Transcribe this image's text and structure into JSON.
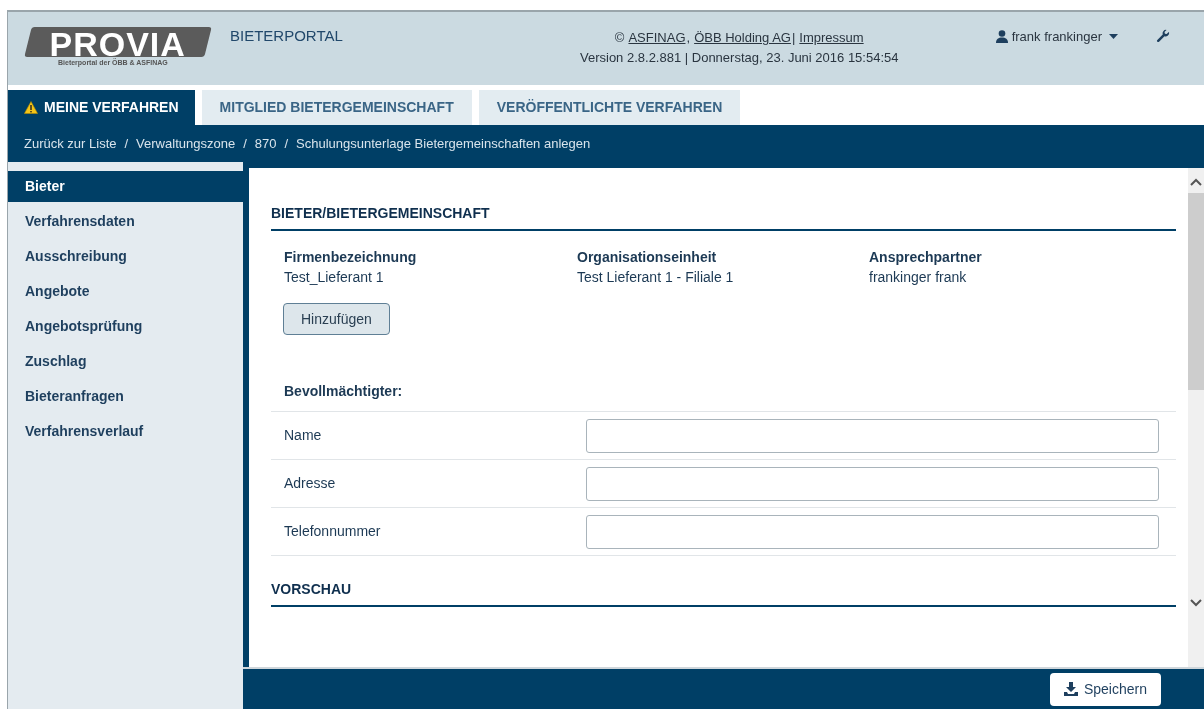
{
  "header": {
    "logo_text": "PROVIA",
    "logo_subtitle": "Bieterportal der ÖBB & ASFINAG",
    "portal_name": "BIETERPORTAL",
    "copyright": {
      "symbol": "©",
      "links": [
        {
          "text": "ASFINAG",
          "after": ","
        },
        {
          "text": "ÖBB Holding AG",
          "after": "|"
        },
        {
          "text": "Impressum"
        }
      ]
    },
    "version": "Version 2.8.2.881 | Donnerstag, 23. Juni 2016 15:54:54",
    "user": "frank frankinger"
  },
  "tabs": [
    {
      "label": "MEINE VERFAHREN",
      "selected": true,
      "alert": true
    },
    {
      "label": "MITGLIED BIETERGEMEINSCHAFT",
      "selected": false,
      "alert": false
    },
    {
      "label": "VERÖFFENTLICHTE VERFAHREN",
      "selected": false,
      "alert": false
    }
  ],
  "breadcrumb": {
    "separator": "/",
    "items": [
      "Zurück zur Liste",
      "Verwaltungszone",
      "870",
      "Schulungsunterlage Bietergemeinschaften anlegen"
    ]
  },
  "sidebar": {
    "items": [
      {
        "label": "Bieter",
        "selected": true
      },
      {
        "label": "Verfahrensdaten",
        "selected": false
      },
      {
        "label": "Ausschreibung",
        "selected": false
      },
      {
        "label": "Angebote",
        "selected": false
      },
      {
        "label": "Angebotsprüfung",
        "selected": false
      },
      {
        "label": "Zuschlag",
        "selected": false
      },
      {
        "label": "Bieteranfragen",
        "selected": false
      },
      {
        "label": "Verfahrensverlauf",
        "selected": false
      }
    ]
  },
  "bidder_section": {
    "title": "BIETER/BIETERGEMEINSCHAFT",
    "columns": [
      {
        "header": "Firmenbezeichnung",
        "value": "Test_Lieferant 1"
      },
      {
        "header": "Organisationseinheit",
        "value": "Test Lieferant 1 - Filiale 1"
      },
      {
        "header": "Ansprechpartner",
        "value": "frankinger frank"
      }
    ],
    "add_button": "Hinzufügen",
    "subheading": "Bevollmächtigter:",
    "fields": [
      {
        "label": "Name"
      },
      {
        "label": "Adresse"
      },
      {
        "label": "Telefonnummer"
      }
    ]
  },
  "preview_section": {
    "title": "VORSCHAU"
  },
  "footer": {
    "save_button": "Speichern"
  }
}
